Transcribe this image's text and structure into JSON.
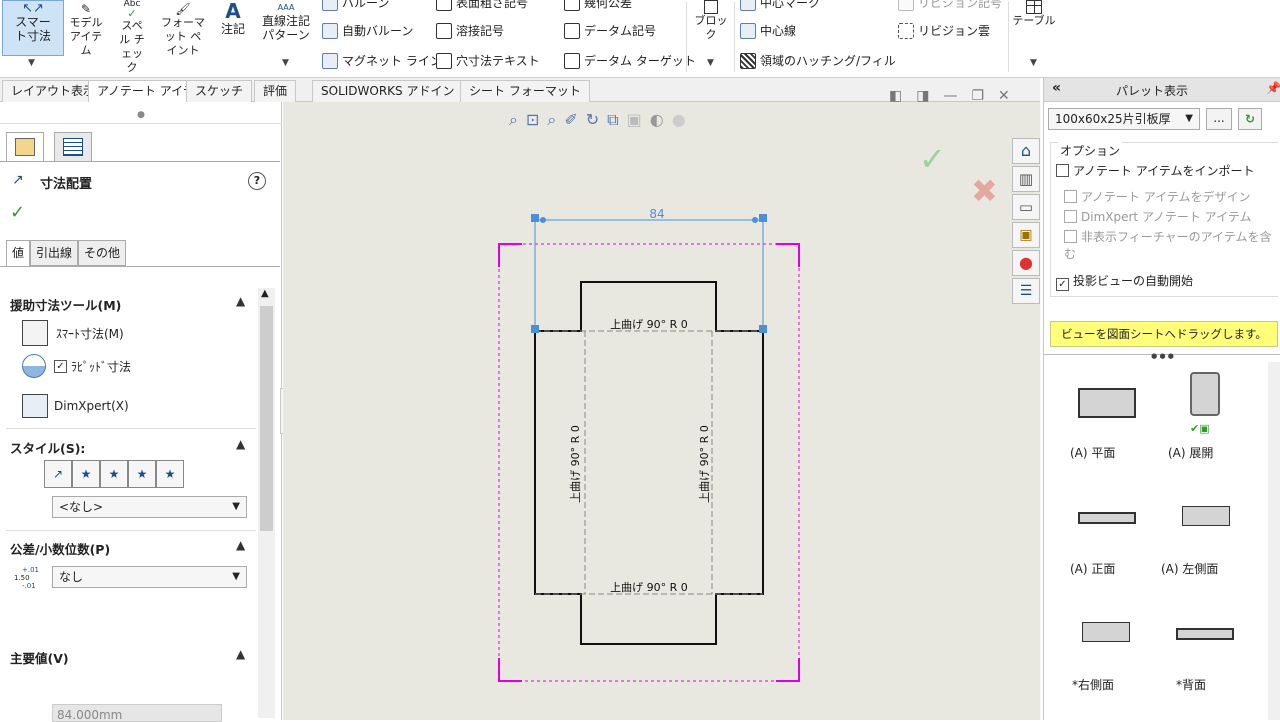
{
  "ribbon": {
    "smart_dim": "スマート寸法",
    "model_items": "モデル アイテム",
    "spell_check": "スペル チェック",
    "abc": "Abc",
    "format_painter": "フォーマット ペイント",
    "note": "注記",
    "linear_pattern": "直線注記パターン",
    "balloon": "バルーン",
    "auto_balloon": "自動バルーン",
    "magnetic_line": "マグネット ライン",
    "surface_finish": "表面粗さ記号",
    "weld_symbol": "溶接記号",
    "hole_callout": "穴寸法テキスト",
    "geo_tol": "幾何公差",
    "datum_feature": "データム記号",
    "datum_target": "データム ターゲット",
    "block": "ブロック",
    "center_mark": "中心マーク",
    "centerline": "中心線",
    "hatch": "領域のハッチング/フィル",
    "revision_symbol": "リビジョン記号",
    "revision_cloud": "リビジョン雲",
    "table": "テーブル"
  },
  "tabs": [
    "レイアウト表示",
    "アノテート アイテム",
    "スケッチ",
    "評価",
    "SOLIDWORKS アドイン",
    "シート フォーマット"
  ],
  "left_panel": {
    "title": "寸法配置",
    "help": "?",
    "ok": "✓",
    "subtabs": [
      "値",
      "引出線",
      "その他"
    ],
    "sec_dim_tools": "援助寸法ツール(M)",
    "smart_dim": "ｽﾏｰﾄ寸法(M)",
    "rapid_dim": "ﾗﾋﾟｯﾄﾞ寸法",
    "dimxpert": "DimXpert(X)",
    "sec_style": "スタイル(S):",
    "style_value": "<なし>",
    "sec_tolerance": "公差/小数位数(P)",
    "tol_icon_top": "+.01",
    "tol_icon_mid": "1.50",
    "tol_icon_bot": "-.01",
    "tol_value": "なし",
    "sec_primary": "主要値(V)",
    "primary_value": "84.000mm"
  },
  "drawing": {
    "dim_value": "84",
    "bend_top": "上曲げ 90° R 0",
    "bend_bottom": "上曲げ 90° R 0",
    "bend_left": "上曲げ 90° R 0",
    "bend_right": "上曲げ 90° R 0"
  },
  "right_panel": {
    "title": "パレット表示",
    "part_select": "100x60x25片引板厚",
    "browse": "...",
    "options_label": "オプション",
    "import_annot": "アノテート アイテムをインポート",
    "design_annot": "アノテート アイテムをデザイン",
    "dimxpert_annot": "DimXpert アノテート アイテム",
    "hidden_feat": "非表示フィーチャーのアイテムを含む",
    "auto_start": "投影ビューの自動開始",
    "drag_hint": "ビューを図面シートへドラッグします。",
    "views": [
      "(A) 平面",
      "(A) 展開",
      "(A) 正面",
      "(A) 左側面",
      "*右側面",
      "*背面"
    ]
  },
  "colors": {
    "accent": "#e100e1",
    "dim": "#4a90d9",
    "ok": "#2e9e2e",
    "hint": "#ffff7a"
  }
}
